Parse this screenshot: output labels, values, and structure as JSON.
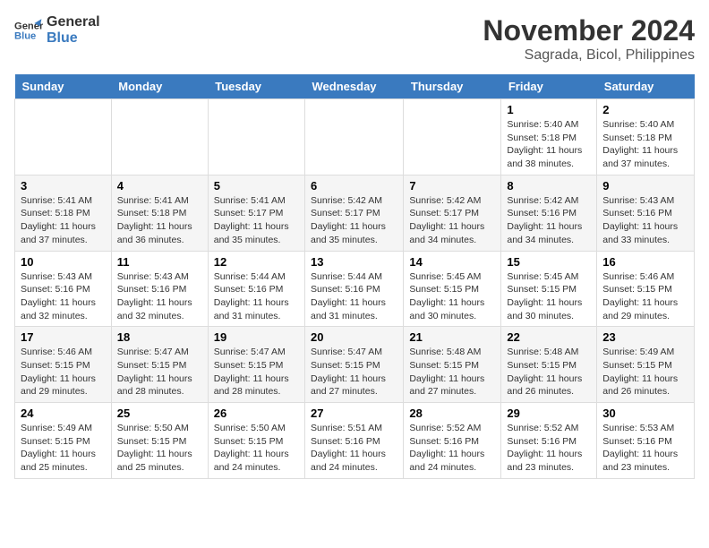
{
  "logo": {
    "line1": "General",
    "line2": "Blue"
  },
  "title": "November 2024",
  "location": "Sagrada, Bicol, Philippines",
  "days_of_week": [
    "Sunday",
    "Monday",
    "Tuesday",
    "Wednesday",
    "Thursday",
    "Friday",
    "Saturday"
  ],
  "weeks": [
    [
      {
        "day": "",
        "info": ""
      },
      {
        "day": "",
        "info": ""
      },
      {
        "day": "",
        "info": ""
      },
      {
        "day": "",
        "info": ""
      },
      {
        "day": "",
        "info": ""
      },
      {
        "day": "1",
        "info": "Sunrise: 5:40 AM\nSunset: 5:18 PM\nDaylight: 11 hours and 38 minutes."
      },
      {
        "day": "2",
        "info": "Sunrise: 5:40 AM\nSunset: 5:18 PM\nDaylight: 11 hours and 37 minutes."
      }
    ],
    [
      {
        "day": "3",
        "info": "Sunrise: 5:41 AM\nSunset: 5:18 PM\nDaylight: 11 hours and 37 minutes."
      },
      {
        "day": "4",
        "info": "Sunrise: 5:41 AM\nSunset: 5:18 PM\nDaylight: 11 hours and 36 minutes."
      },
      {
        "day": "5",
        "info": "Sunrise: 5:41 AM\nSunset: 5:17 PM\nDaylight: 11 hours and 35 minutes."
      },
      {
        "day": "6",
        "info": "Sunrise: 5:42 AM\nSunset: 5:17 PM\nDaylight: 11 hours and 35 minutes."
      },
      {
        "day": "7",
        "info": "Sunrise: 5:42 AM\nSunset: 5:17 PM\nDaylight: 11 hours and 34 minutes."
      },
      {
        "day": "8",
        "info": "Sunrise: 5:42 AM\nSunset: 5:16 PM\nDaylight: 11 hours and 34 minutes."
      },
      {
        "day": "9",
        "info": "Sunrise: 5:43 AM\nSunset: 5:16 PM\nDaylight: 11 hours and 33 minutes."
      }
    ],
    [
      {
        "day": "10",
        "info": "Sunrise: 5:43 AM\nSunset: 5:16 PM\nDaylight: 11 hours and 32 minutes."
      },
      {
        "day": "11",
        "info": "Sunrise: 5:43 AM\nSunset: 5:16 PM\nDaylight: 11 hours and 32 minutes."
      },
      {
        "day": "12",
        "info": "Sunrise: 5:44 AM\nSunset: 5:16 PM\nDaylight: 11 hours and 31 minutes."
      },
      {
        "day": "13",
        "info": "Sunrise: 5:44 AM\nSunset: 5:16 PM\nDaylight: 11 hours and 31 minutes."
      },
      {
        "day": "14",
        "info": "Sunrise: 5:45 AM\nSunset: 5:15 PM\nDaylight: 11 hours and 30 minutes."
      },
      {
        "day": "15",
        "info": "Sunrise: 5:45 AM\nSunset: 5:15 PM\nDaylight: 11 hours and 30 minutes."
      },
      {
        "day": "16",
        "info": "Sunrise: 5:46 AM\nSunset: 5:15 PM\nDaylight: 11 hours and 29 minutes."
      }
    ],
    [
      {
        "day": "17",
        "info": "Sunrise: 5:46 AM\nSunset: 5:15 PM\nDaylight: 11 hours and 29 minutes."
      },
      {
        "day": "18",
        "info": "Sunrise: 5:47 AM\nSunset: 5:15 PM\nDaylight: 11 hours and 28 minutes."
      },
      {
        "day": "19",
        "info": "Sunrise: 5:47 AM\nSunset: 5:15 PM\nDaylight: 11 hours and 28 minutes."
      },
      {
        "day": "20",
        "info": "Sunrise: 5:47 AM\nSunset: 5:15 PM\nDaylight: 11 hours and 27 minutes."
      },
      {
        "day": "21",
        "info": "Sunrise: 5:48 AM\nSunset: 5:15 PM\nDaylight: 11 hours and 27 minutes."
      },
      {
        "day": "22",
        "info": "Sunrise: 5:48 AM\nSunset: 5:15 PM\nDaylight: 11 hours and 26 minutes."
      },
      {
        "day": "23",
        "info": "Sunrise: 5:49 AM\nSunset: 5:15 PM\nDaylight: 11 hours and 26 minutes."
      }
    ],
    [
      {
        "day": "24",
        "info": "Sunrise: 5:49 AM\nSunset: 5:15 PM\nDaylight: 11 hours and 25 minutes."
      },
      {
        "day": "25",
        "info": "Sunrise: 5:50 AM\nSunset: 5:15 PM\nDaylight: 11 hours and 25 minutes."
      },
      {
        "day": "26",
        "info": "Sunrise: 5:50 AM\nSunset: 5:15 PM\nDaylight: 11 hours and 24 minutes."
      },
      {
        "day": "27",
        "info": "Sunrise: 5:51 AM\nSunset: 5:16 PM\nDaylight: 11 hours and 24 minutes."
      },
      {
        "day": "28",
        "info": "Sunrise: 5:52 AM\nSunset: 5:16 PM\nDaylight: 11 hours and 24 minutes."
      },
      {
        "day": "29",
        "info": "Sunrise: 5:52 AM\nSunset: 5:16 PM\nDaylight: 11 hours and 23 minutes."
      },
      {
        "day": "30",
        "info": "Sunrise: 5:53 AM\nSunset: 5:16 PM\nDaylight: 11 hours and 23 minutes."
      }
    ]
  ]
}
